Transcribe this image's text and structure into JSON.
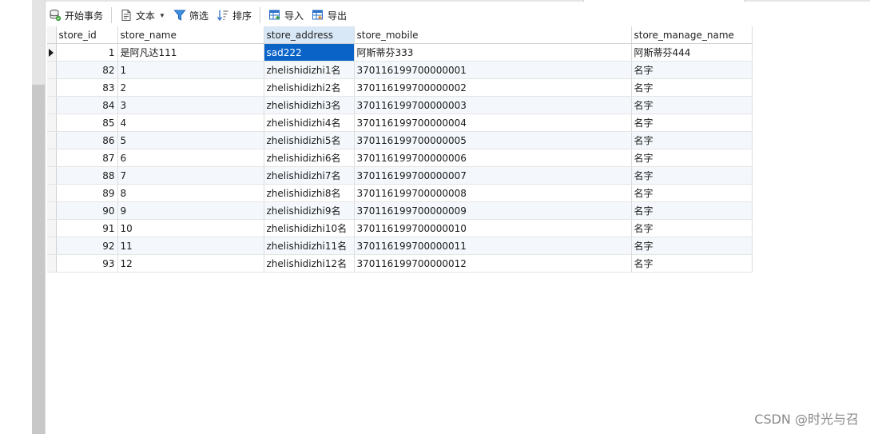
{
  "toolbar": {
    "begin_transaction": "开始事务",
    "text": "文本",
    "filter": "筛选",
    "sort": "排序",
    "import": "导入",
    "export": "导出"
  },
  "grid": {
    "columns": [
      "store_id",
      "store_name",
      "store_address",
      "store_mobile",
      "store_manage_name"
    ],
    "selected_column": "store_address",
    "rows": [
      {
        "store_id": "1",
        "store_name": "是阿凡达111",
        "store_address": "sad222",
        "store_mobile": "阿斯蒂芬333",
        "store_manage_name": "阿斯蒂芬444"
      },
      {
        "store_id": "82",
        "store_name": "1",
        "store_address": "zhelishidizhi1名",
        "store_mobile": "370116199700000001",
        "store_manage_name": "名字"
      },
      {
        "store_id": "83",
        "store_name": "2",
        "store_address": "zhelishidizhi2名",
        "store_mobile": "370116199700000002",
        "store_manage_name": "名字"
      },
      {
        "store_id": "84",
        "store_name": "3",
        "store_address": "zhelishidizhi3名",
        "store_mobile": "370116199700000003",
        "store_manage_name": "名字"
      },
      {
        "store_id": "85",
        "store_name": "4",
        "store_address": "zhelishidizhi4名",
        "store_mobile": "370116199700000004",
        "store_manage_name": "名字"
      },
      {
        "store_id": "86",
        "store_name": "5",
        "store_address": "zhelishidizhi5名",
        "store_mobile": "370116199700000005",
        "store_manage_name": "名字"
      },
      {
        "store_id": "87",
        "store_name": "6",
        "store_address": "zhelishidizhi6名",
        "store_mobile": "370116199700000006",
        "store_manage_name": "名字"
      },
      {
        "store_id": "88",
        "store_name": "7",
        "store_address": "zhelishidizhi7名",
        "store_mobile": "370116199700000007",
        "store_manage_name": "名字"
      },
      {
        "store_id": "89",
        "store_name": "8",
        "store_address": "zhelishidizhi8名",
        "store_mobile": "370116199700000008",
        "store_manage_name": "名字"
      },
      {
        "store_id": "90",
        "store_name": "9",
        "store_address": "zhelishidizhi9名",
        "store_mobile": "370116199700000009",
        "store_manage_name": "名字"
      },
      {
        "store_id": "91",
        "store_name": "10",
        "store_address": "zhelishidizhi10名",
        "store_mobile": "370116199700000010",
        "store_manage_name": "名字"
      },
      {
        "store_id": "92",
        "store_name": "11",
        "store_address": "zhelishidizhi11名",
        "store_mobile": "370116199700000011",
        "store_manage_name": "名字"
      },
      {
        "store_id": "93",
        "store_name": "12",
        "store_address": "zhelishidizhi12名",
        "store_mobile": "370116199700000012",
        "store_manage_name": "名字"
      }
    ],
    "active_row": 0,
    "active_column": "store_address",
    "highlight_color": "#0a64c8"
  },
  "watermark": "CSDN @时光与召"
}
